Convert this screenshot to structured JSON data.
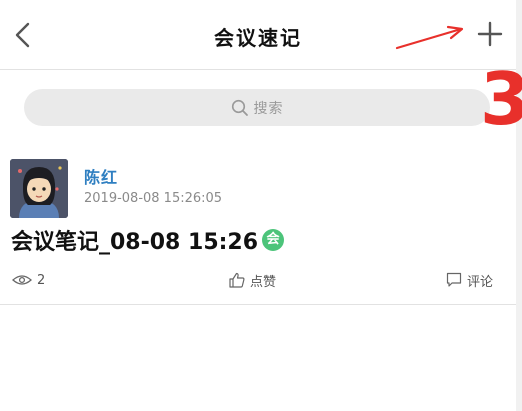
{
  "header": {
    "title": "会议速记",
    "back_icon": "chevron-left-icon",
    "add_icon": "plus-icon"
  },
  "search": {
    "placeholder": "搜索",
    "icon": "search-icon"
  },
  "post": {
    "author": "陈红",
    "timestamp": "2019-08-08 15:26:05",
    "title": "会议笔记_08-08 15:26",
    "badge": "会",
    "badge_color": "#4cc47a",
    "views": "2",
    "like_label": "点赞",
    "comment_label": "评论"
  },
  "annotation": {
    "label": "3",
    "color": "#e8302b"
  }
}
